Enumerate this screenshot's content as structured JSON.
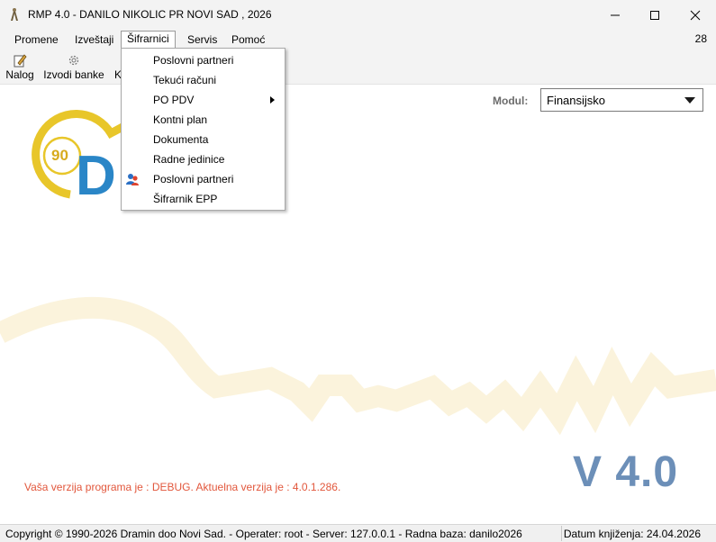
{
  "window": {
    "title": "RMP 4.0 - DANILO NIKOLIC PR NOVI SAD , 2026",
    "controls": [
      "minimize",
      "maximize",
      "close"
    ]
  },
  "menubar": {
    "items": [
      {
        "label": "Promene"
      },
      {
        "label": "Izveštaji"
      },
      {
        "label": "Šifrarnici",
        "active": true
      },
      {
        "label": "Servis"
      },
      {
        "label": "Pomoć"
      }
    ],
    "counter": "28"
  },
  "toolbar": {
    "items": [
      {
        "label": "Nalog",
        "icon": "pencil-document-icon"
      },
      {
        "label": "Izvodi banke",
        "icon": "gear-icon"
      },
      {
        "label": "K",
        "icon": "none"
      }
    ]
  },
  "dropdown": {
    "items": [
      {
        "label": "Poslovni partneri"
      },
      {
        "label": "Tekući računi"
      },
      {
        "label": "PO PDV",
        "has_submenu": true
      },
      {
        "label": "Kontni plan"
      },
      {
        "label": "Dokumenta"
      },
      {
        "label": "Radne jedinice"
      },
      {
        "label": "Poslovni partneri",
        "icon": "users-icon"
      },
      {
        "label": "Šifrarnik EPP"
      }
    ]
  },
  "modul": {
    "label": "Modul:",
    "value": "Finansijsko"
  },
  "logo": {
    "badge": "90",
    "text": "D"
  },
  "version": {
    "big": "V 4.0",
    "note": "Vaša verzija programa je : DEBUG. Aktuelna verzija je : 4.0.1.286."
  },
  "status": {
    "left": "Copyright © 1990-2026 Dramin doo Novi Sad. - Operater: root - Server: 127.0.0.1 - Radna baza: danilo2026",
    "right": "Datum knjiženja: 24.04.2026"
  },
  "colors": {
    "chrome_bg": "#f3f3f3",
    "version_blue": "#6c8fb8",
    "debug_red": "#e2573c",
    "logo_gold": "#e8c62a",
    "logo_blue": "#2a86c7",
    "watermark": "#fbf3dc"
  }
}
